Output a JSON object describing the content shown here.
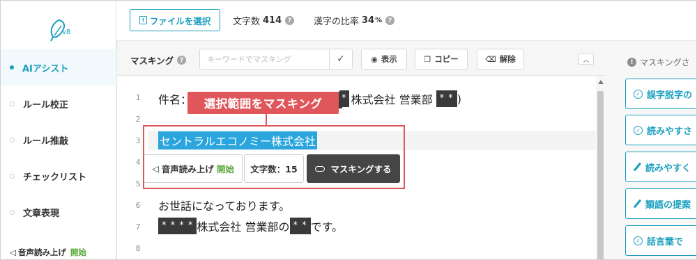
{
  "app": {
    "version": "v8"
  },
  "sidebar": {
    "items": [
      {
        "label": "AIアシスト",
        "active": true
      },
      {
        "label": "ルール校正",
        "active": false
      },
      {
        "label": "ルール推敲",
        "active": false
      },
      {
        "label": "チェックリスト",
        "active": false
      },
      {
        "label": "文章表現",
        "active": false
      }
    ],
    "tts_label": "音声読み上げ",
    "tts_start": "開始"
  },
  "topbar": {
    "file_button": "ファイルを選択",
    "char_count_label": "文字数",
    "char_count_value": "414",
    "kanji_label": "漢字の比率",
    "kanji_value": "34",
    "kanji_unit": "%"
  },
  "masking": {
    "label": "マスキング",
    "placeholder": "キーワードでマスキング",
    "show_button": "表示",
    "copy_button": "コピー",
    "release_button": "解除"
  },
  "editor": {
    "line_numbers": [
      "1",
      "2",
      "3",
      "4",
      "5",
      "6",
      "7",
      "8"
    ],
    "line1_prefix": "件名：",
    "line1_mask1": "*",
    "line1_middle": "株式会社 営業部",
    "line1_mask2": "* *",
    "line1_suffix": ")",
    "line3_selected": "セントラルエコノミー株式会社",
    "line6": "お世話になっております。",
    "line7_mask1": "* * * *",
    "line7_middle": "株式会社 営業部の",
    "line7_mask2": "* *",
    "line7_suffix": "です。"
  },
  "popup": {
    "tts_label": "音声読み上げ",
    "tts_start": "開始",
    "char_count": "文字数：15",
    "mask_button": "マスキングする"
  },
  "annotation": {
    "callout": "選択範囲をマスキング"
  },
  "right_panel": {
    "header": "マスキングさ",
    "cards": [
      {
        "label": "誤字脱字の",
        "icon": "check-circle-icon"
      },
      {
        "label": "読みやすさ",
        "icon": "check-circle-icon"
      },
      {
        "label": "読みやすく",
        "icon": "pen-icon"
      },
      {
        "label": "類語の提案",
        "icon": "pen-icon"
      },
      {
        "label": "話言葉で",
        "icon": "check-circle-icon"
      }
    ]
  },
  "colors": {
    "accent": "#1a9fbf",
    "callout_red": "#e0575b",
    "start_green": "#58a93a",
    "selection_blue": "#2aa5dd"
  }
}
